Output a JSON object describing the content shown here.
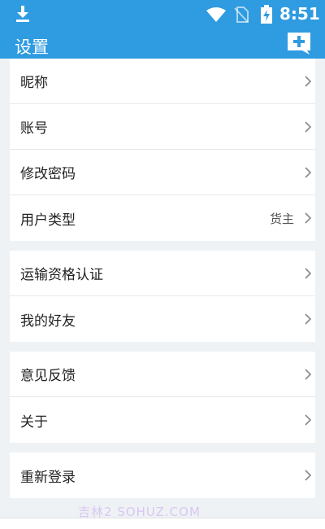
{
  "status_bar": {
    "time": "8:51",
    "icons": [
      "download-icon",
      "wifi-icon",
      "no-sim-icon",
      "battery-charging-icon"
    ]
  },
  "header": {
    "title": "设置",
    "add_button_icon": "add-message-icon"
  },
  "colors": {
    "header_bg": "#2f9be0",
    "page_bg": "#eef2f4",
    "row_bg": "#ffffff"
  },
  "groups": [
    {
      "rows": [
        {
          "label": "昵称",
          "value": ""
        },
        {
          "label": "账号",
          "value": ""
        },
        {
          "label": "修改密码",
          "value": ""
        },
        {
          "label": "用户类型",
          "value": "货主"
        }
      ]
    },
    {
      "rows": [
        {
          "label": "运输资格认证",
          "value": ""
        },
        {
          "label": "我的好友",
          "value": ""
        }
      ]
    },
    {
      "rows": [
        {
          "label": "意见反馈",
          "value": ""
        },
        {
          "label": "关于",
          "value": ""
        }
      ]
    },
    {
      "rows": [
        {
          "label": "重新登录",
          "value": ""
        }
      ]
    }
  ],
  "watermark": "吉林2 SOHUZ.COM"
}
